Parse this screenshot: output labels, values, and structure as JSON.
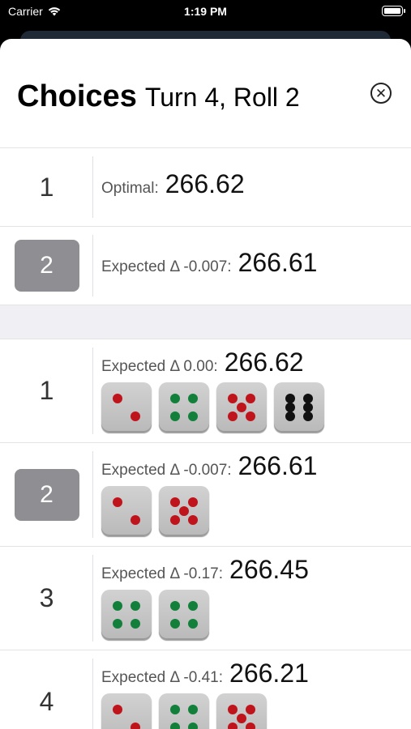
{
  "status_bar": {
    "carrier": "Carrier",
    "time": "1:19 PM"
  },
  "header": {
    "title_bold": "Choices",
    "title_sub": "Turn 4, Roll 2",
    "close_icon": "close-circle-icon"
  },
  "summary": [
    {
      "number": "1",
      "label": "Optimal:",
      "value": "266.62",
      "selected": false
    },
    {
      "number": "2",
      "label": "Expected Δ -0.007:",
      "value": "266.61",
      "selected": true
    }
  ],
  "choices": [
    {
      "number": "1",
      "label": "Expected Δ 0.00:",
      "value": "266.62",
      "selected": false,
      "dice": [
        {
          "face": 2,
          "color": "red"
        },
        {
          "face": 4,
          "color": "green"
        },
        {
          "face": 5,
          "color": "red"
        },
        {
          "face": 6,
          "color": "black"
        }
      ]
    },
    {
      "number": "2",
      "label": "Expected Δ -0.007:",
      "value": "266.61",
      "selected": true,
      "dice": [
        {
          "face": 2,
          "color": "red"
        },
        {
          "face": 5,
          "color": "red"
        }
      ]
    },
    {
      "number": "3",
      "label": "Expected Δ -0.17:",
      "value": "266.45",
      "selected": false,
      "dice": [
        {
          "face": 4,
          "color": "green"
        },
        {
          "face": 4,
          "color": "green"
        }
      ]
    },
    {
      "number": "4",
      "label": "Expected Δ -0.41:",
      "value": "266.21",
      "selected": false,
      "dice": [
        {
          "face": 2,
          "color": "red"
        },
        {
          "face": 4,
          "color": "green"
        },
        {
          "face": 5,
          "color": "red"
        }
      ]
    }
  ],
  "colors": {
    "selected_pill": "#8e8e93",
    "red_pip": "#c0141c",
    "green_pip": "#12803a",
    "black_pip": "#111111"
  }
}
